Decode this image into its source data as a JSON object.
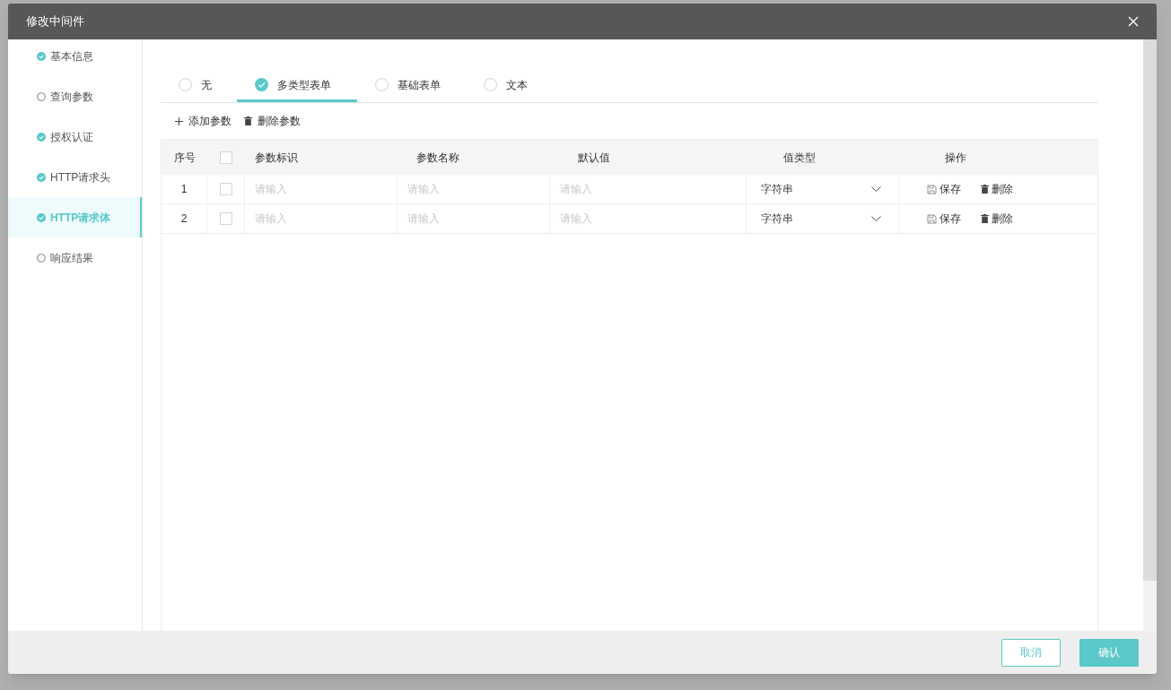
{
  "dialog": {
    "title": "修改中间件"
  },
  "steps": [
    {
      "label": "基本信息",
      "done": true,
      "selected": false
    },
    {
      "label": "查询参数",
      "done": false,
      "selected": false
    },
    {
      "label": "授权认证",
      "done": true,
      "selected": false
    },
    {
      "label": "HTTP请求头",
      "done": true,
      "selected": false
    },
    {
      "label": "HTTP请求体",
      "done": true,
      "selected": true
    },
    {
      "label": "响应结果",
      "done": false,
      "selected": false
    }
  ],
  "body_types": [
    {
      "label": "无",
      "selected": false
    },
    {
      "label": "多类型表单",
      "selected": true
    },
    {
      "label": "基础表单",
      "selected": false
    },
    {
      "label": "文本",
      "selected": false
    }
  ],
  "toolbar": [
    {
      "label": "添加参数",
      "kind": "add"
    },
    {
      "label": "删除参数",
      "kind": "delete"
    }
  ],
  "table": {
    "columns": [
      "序号",
      "参数标识",
      "参数名称",
      "默认值",
      "值类型",
      "操作"
    ],
    "select_all_checked": false,
    "rows": [
      {
        "index": "1",
        "checked": false,
        "key_placeholder": "请输入",
        "name_placeholder": "请输入",
        "default_placeholder": "请输入",
        "type": "字符串",
        "actions": [
          "保存",
          "删除"
        ]
      },
      {
        "index": "2",
        "checked": false,
        "key_placeholder": "请输入",
        "name_placeholder": "请输入",
        "default_placeholder": "请输入",
        "type": "字符串",
        "actions": [
          "保存",
          "删除"
        ]
      }
    ]
  },
  "buttons": [
    {
      "label": "取消",
      "kind": "secondary"
    },
    {
      "label": "确认",
      "kind": "primary"
    }
  ]
}
